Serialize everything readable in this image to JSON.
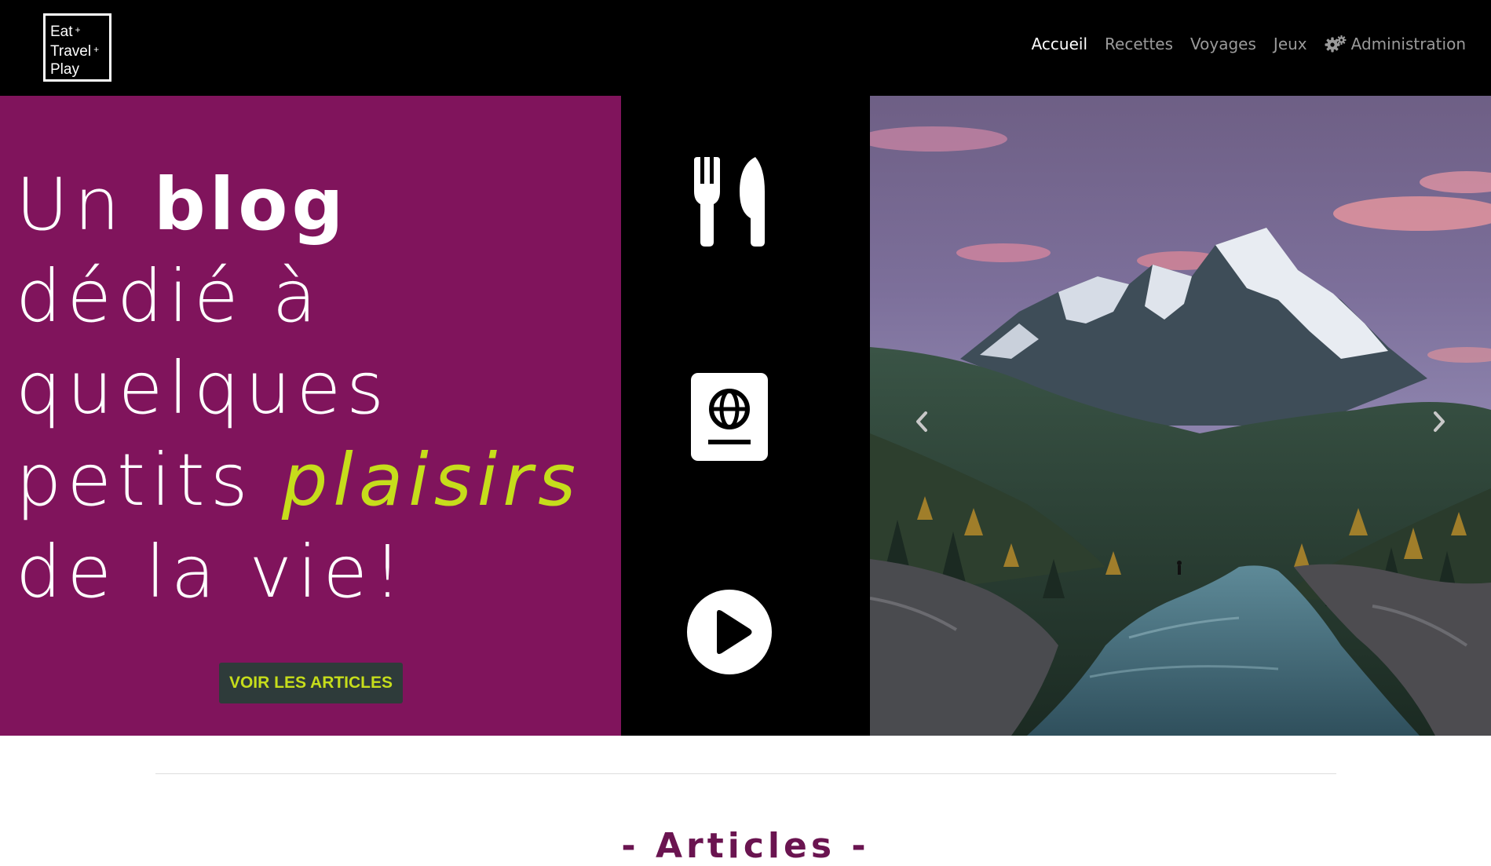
{
  "brand": {
    "logo_lines": [
      "Eat",
      "Travel",
      "Play"
    ],
    "logo_plus": "+"
  },
  "nav": {
    "items": [
      {
        "label": "Accueil",
        "active": true
      },
      {
        "label": "Recettes",
        "active": false
      },
      {
        "label": "Voyages",
        "active": false
      },
      {
        "label": "Jeux",
        "active": false
      }
    ],
    "admin_label": "Administration",
    "admin_icon": "gears-icon"
  },
  "hero": {
    "heading": {
      "w1": "Un",
      "w2": "blog",
      "line2": "dédié à",
      "line3": "quelques",
      "w4a": "petits",
      "w4b": "plaisirs",
      "line5": "de la vie!"
    },
    "cta_label": "Voir les articles",
    "categories": [
      {
        "name": "Recettes",
        "icon": "fork-knife-icon"
      },
      {
        "name": "Voyages",
        "icon": "passport-icon"
      },
      {
        "name": "Jeux",
        "icon": "play-circle-icon"
      }
    ],
    "carousel": {
      "prev_icon": "chevron-left-icon",
      "next_icon": "chevron-right-icon"
    }
  },
  "section": {
    "articles_title": "- Articles -"
  },
  "colors": {
    "hero_purple": "#80145c",
    "accent_lime": "#c6dd1b",
    "button_dark": "#2e3b3a",
    "title_purple": "#6a1450"
  }
}
